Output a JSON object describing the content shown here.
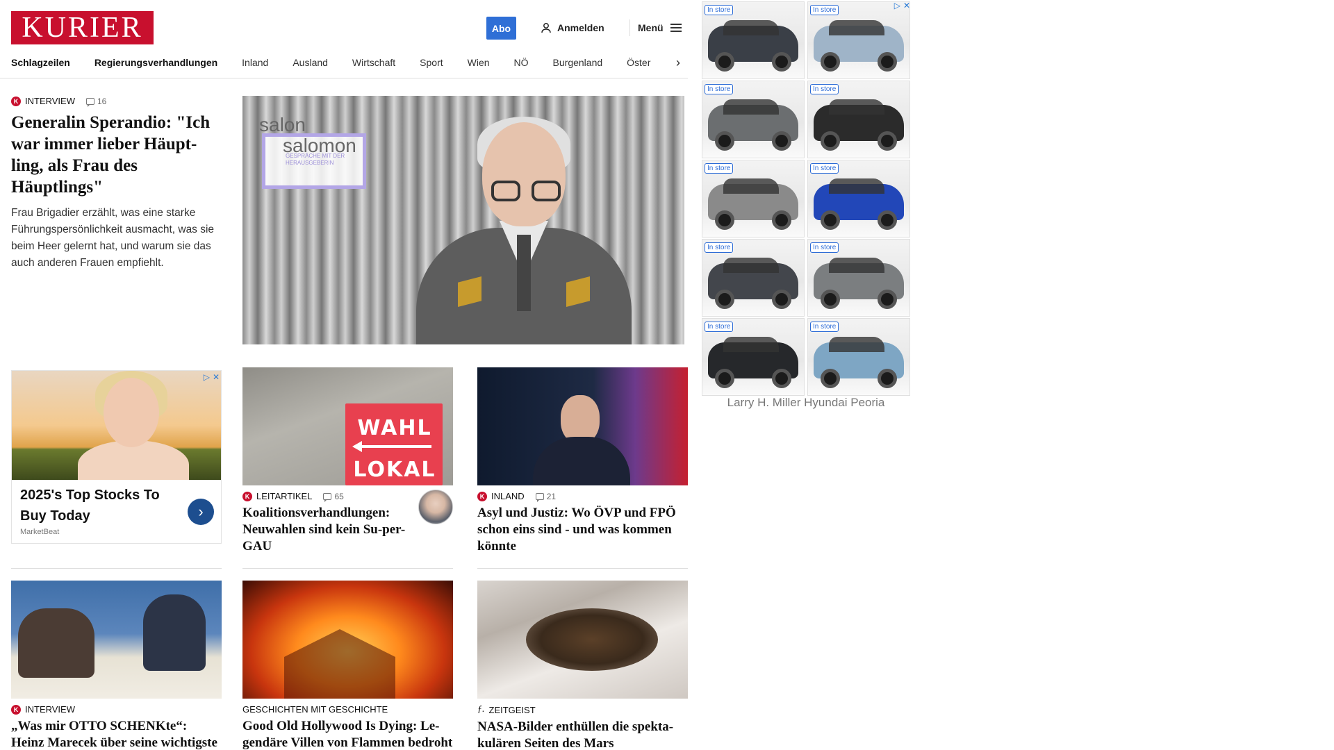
{
  "header": {
    "logo": "KURIER",
    "abo_label": "Abo",
    "login_label": "Anmelden",
    "menu_label": "Menü"
  },
  "nav": {
    "items": [
      "Schlagzeilen",
      "Regierungsverhandlungen",
      "Inland",
      "Ausland",
      "Wirtschaft",
      "Sport",
      "Wien",
      "NÖ",
      "Burgenland",
      "Öster"
    ]
  },
  "lead": {
    "category": "INTERVIEW",
    "comments": "16",
    "title": "Generalin Sperandio: \"Ich war immer lieber Häupt-ling, als Frau des Häuptlings\"",
    "teaser": "Frau Brigadier erzählt, was eine starke Führungspersönlichkeit ausmacht, was sie beim Heer gelernt hat, und warum sie das auch anderen Frauen empfiehlt.",
    "image_overlay": {
      "word1": "salon",
      "word2": "salomon",
      "subtitle": "GESPRÄCHE MIT DER HERAUSGEBERIN"
    }
  },
  "ad_card": {
    "headline": "2025's Top Stocks To Buy Today",
    "brand": "MarketBeat",
    "arrow": "›"
  },
  "articles_row1": [
    {
      "category": "LEITARTIKEL",
      "comments": "65",
      "title": "Koalitionsverhandlungen: Neuwahlen sind kein Su-per-GAU",
      "sign_top": "WAHL",
      "sign_bottom": "LOKAL"
    },
    {
      "category": "INLAND",
      "comments": "21",
      "title": "Asyl und Justiz: Wo ÖVP und FPÖ schon eins sind - und was kommen könnte"
    }
  ],
  "articles_row2": [
    {
      "category": "INTERVIEW",
      "title": "„Was mir OTTO SCHENKte“: Heinz Marecek über seine wichtigste Lebensfigur"
    },
    {
      "category": "GESCHICHTEN MIT GESCHICHTE",
      "title": "Good Old Hollywood Is Dying: Le-gendäre Villen von Flammen bedroht"
    },
    {
      "category": "ZEITGEIST",
      "title": "NASA-Bilder enthüllen die spekta-kulären Seiten des Mars"
    }
  ],
  "side_ad": {
    "badge": "In store",
    "dealer": "Larry H. Miller Hyundai Peoria",
    "car_colors": [
      "#3a3f47",
      "#9fb4c8",
      "#6b6e70",
      "#2b2b2b",
      "#8a8a8a",
      "#2247b8",
      "#43464c",
      "#7b7e80",
      "#26282b",
      "#7ea6c4"
    ]
  },
  "icons": {
    "user": "user-icon",
    "menu": "hamburger-icon",
    "comment": "comment-icon",
    "adchoices": "adchoices-icon",
    "close": "close-icon"
  }
}
